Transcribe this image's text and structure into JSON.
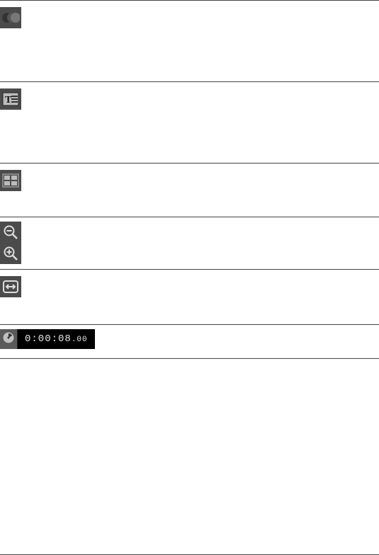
{
  "lines": {
    "l1": 0,
    "l2": 115,
    "l3": 230,
    "l4": 306,
    "l5": 380,
    "l6": 458,
    "l7": 506,
    "l8": 783
  },
  "timecode": {
    "main": "0:00:08",
    "frac": ".00"
  },
  "icons": {
    "transitions": "transitions-icon",
    "titles": "titles-icon",
    "grid": "templates-grid-icon",
    "zoom_out": "zoom-out-icon",
    "zoom_in": "zoom-in-icon",
    "fit": "fit-to-window-icon",
    "clock": "clock-icon"
  }
}
